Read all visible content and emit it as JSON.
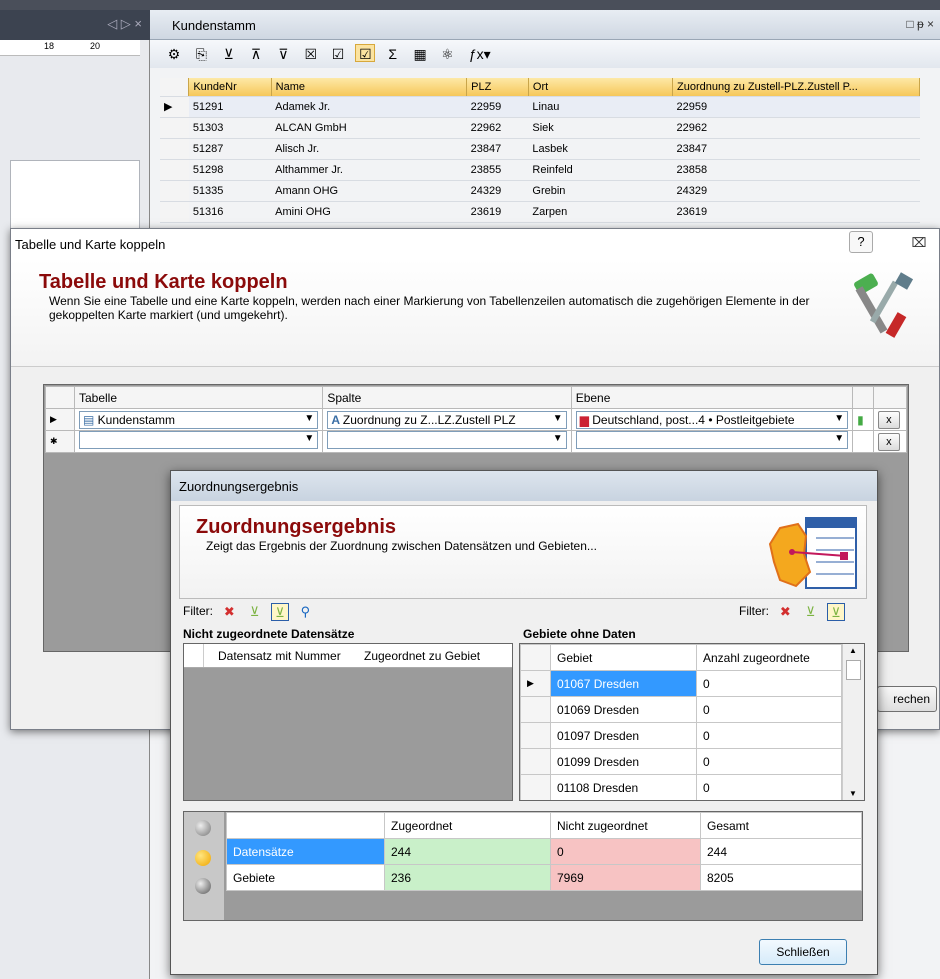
{
  "background": {
    "ruler_labels": [
      "18",
      "20"
    ],
    "kunden_window": {
      "title": "Kundenstamm",
      "controls": "□ ᵽ ×",
      "columns": [
        "KundeNr",
        "Name",
        "PLZ",
        "Ort",
        "Zuordnung zu Zustell-PLZ.Zustell P..."
      ],
      "rows": [
        [
          "51291",
          "Adamek Jr.",
          "22959",
          "Linau",
          "22959"
        ],
        [
          "51303",
          "ALCAN GmbH",
          "22962",
          "Siek",
          "22962"
        ],
        [
          "51287",
          "Alisch Jr.",
          "23847",
          "Lasbek",
          "23847"
        ],
        [
          "51298",
          "Althammer Jr.",
          "23855",
          "Reinfeld",
          "23858"
        ],
        [
          "51335",
          "Amann OHG",
          "24329",
          "Grebin",
          "24329"
        ],
        [
          "51316",
          "Amini OHG",
          "23619",
          "Zarpen",
          "23619"
        ]
      ]
    }
  },
  "dialog1": {
    "title": "Tabelle und Karte koppeln",
    "help_symbol": "?",
    "close_symbol": "⌧",
    "header_title": "Tabelle und Karte koppeln",
    "header_desc": "Wenn Sie eine Tabelle und eine Karte koppeln, werden nach einer Markierung von Tabellenzeilen automatisch die zugehörigen Elemente in der gekoppelten Karte markiert (und umgekehrt).",
    "col_tabelle": "Tabelle",
    "col_spalte": "Spalte",
    "col_ebene": "Ebene",
    "row_tabelle": "Kundenstamm",
    "row_spalte": "Zuordnung zu Z...LZ.Zustell PLZ",
    "row_ebene": "Deutschland, post...4 • Postleitgebiete",
    "x_label": "x",
    "footer_btn": "rechen"
  },
  "dialog2": {
    "title": "Zuordnungsergebnis",
    "header_title": "Zuordnungsergebnis",
    "header_desc": "Zeigt das Ergebnis der Zuordnung zwischen Datensätzen und Gebieten...",
    "filter_label": "Filter:",
    "left_section": "Nicht zugeordnete Datensätze",
    "left_col1": "Datensatz mit Nummer",
    "left_col2": "Zugeordnet zu Gebiet",
    "right_section": "Gebiete ohne Daten",
    "right_col1": "Gebiet",
    "right_col2": "Anzahl zugeordnete",
    "gebiete": [
      {
        "name": "01067 Dresden",
        "count": "0"
      },
      {
        "name": "01069 Dresden",
        "count": "0"
      },
      {
        "name": "01097 Dresden",
        "count": "0"
      },
      {
        "name": "01099 Dresden",
        "count": "0"
      },
      {
        "name": "01108 Dresden",
        "count": "0"
      }
    ],
    "stats_cols": [
      "Zugeordnet",
      "Nicht zugeordnet",
      "Gesamt"
    ],
    "stats_rows": [
      {
        "label": "Datensätze",
        "zugeordnet": "244",
        "nicht": "0",
        "gesamt": "244"
      },
      {
        "label": "Gebiete",
        "zugeordnet": "236",
        "nicht": "7969",
        "gesamt": "8205"
      }
    ],
    "close_btn": "Schließen"
  }
}
